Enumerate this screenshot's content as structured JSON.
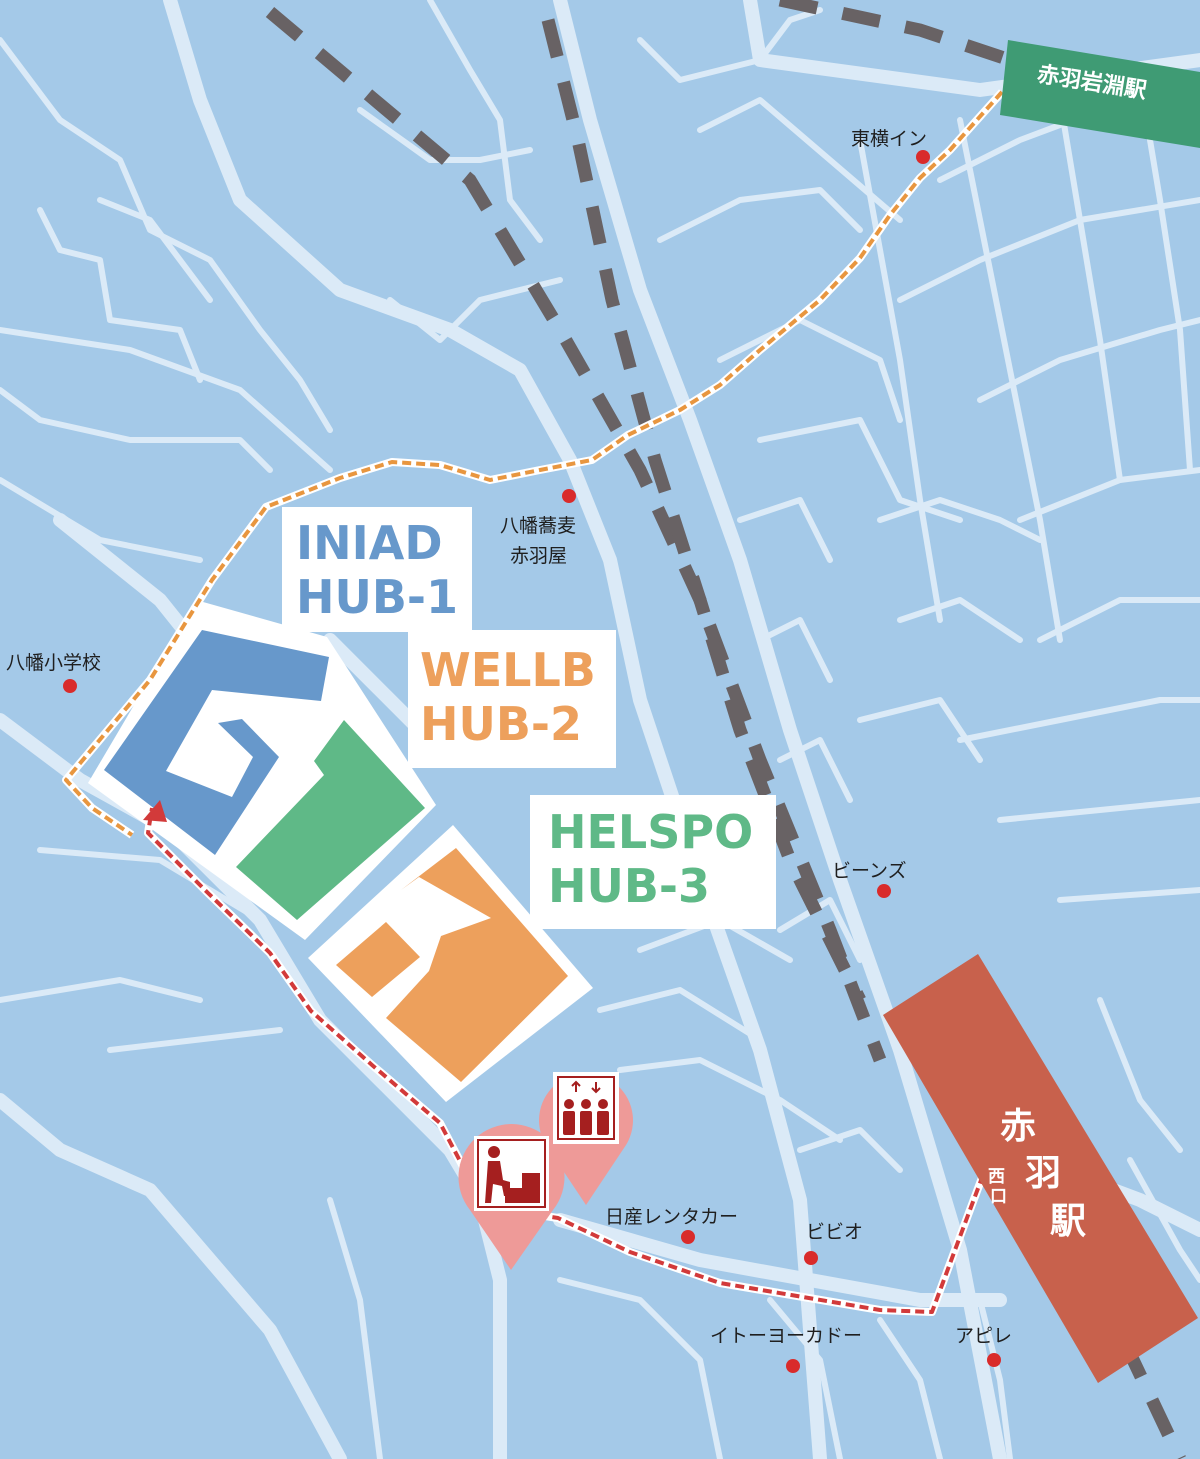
{
  "map": {
    "colors": {
      "background": "#a4c9e8",
      "road": "#dbeaf7",
      "rail": "#686264",
      "route_orange": "#e8963f",
      "route_red": "#d23a3a",
      "poi_dot": "#d92b2b",
      "hub1": "#6798cb",
      "hub2": "#5fb987",
      "hub3": "#eda05c",
      "station": "#c8614c",
      "station_green": "#3f9b74",
      "pin": "#ee9a98",
      "pin_icon": "#a51f1f"
    },
    "stations": {
      "akabane_iwabuchi": "赤羽岩淵駅",
      "akabane": [
        "赤",
        "羽",
        "駅"
      ],
      "akabane_exit": [
        "西",
        "口"
      ]
    },
    "buildings": {
      "hub1": {
        "line1": "INIAD",
        "line2": "HUB-1"
      },
      "hub2": {
        "line1": "WELLB",
        "line2": "HUB-2"
      },
      "hub3": {
        "line1": "HELSPO",
        "line2": "HUB-3"
      }
    },
    "places": {
      "toyoko_inn": "東横イン",
      "soba_line1": "八幡蕎麦",
      "soba_line2": "赤羽屋",
      "hachiman_school": "八幡小学校",
      "beans": "ビーンズ",
      "nissan_rentacar": "日産レンタカー",
      "vivio": "ビビオ",
      "ito_yokado": "イトーヨーカドー",
      "apire": "アピレ"
    },
    "pins": {
      "stairs": "stairs-icon",
      "elevator": "elevator-icon"
    }
  }
}
